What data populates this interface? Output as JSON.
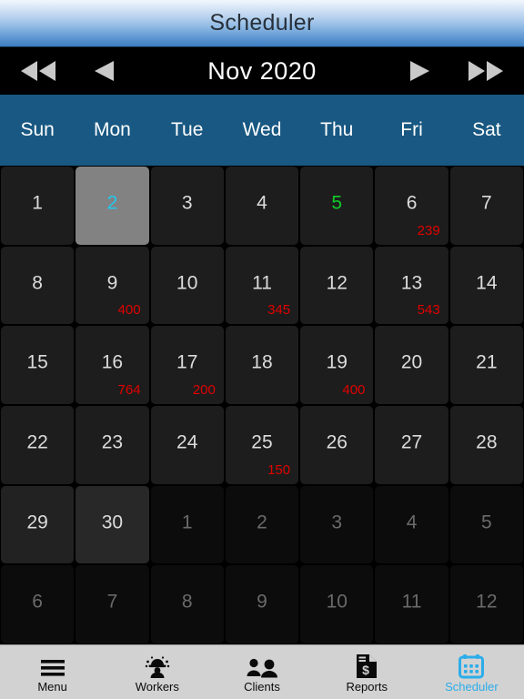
{
  "titlebar": {
    "title": "Scheduler"
  },
  "nav": {
    "month_label": "Nov 2020",
    "prev_year_icon": "double-chevron-left-icon",
    "prev_month_icon": "chevron-left-icon",
    "next_month_icon": "chevron-right-icon",
    "next_year_icon": "double-chevron-right-icon"
  },
  "weekdays": [
    "Sun",
    "Mon",
    "Tue",
    "Wed",
    "Thu",
    "Fri",
    "Sat"
  ],
  "colors": {
    "header_blue": "#185882",
    "selected_cell": "#828282",
    "selected_text": "#21c8ee",
    "today_text": "#10cc28",
    "amount_red": "#e10000",
    "active_tab": "#2badea",
    "cell_bg": "#1d1d1d",
    "adjacent_cell_bg": "#0c0c0c"
  },
  "calendar": {
    "month": "Nov",
    "year": "2020",
    "weeks": [
      [
        {
          "day": "1",
          "amount": "",
          "state": "normal"
        },
        {
          "day": "2",
          "amount": "",
          "state": "selected"
        },
        {
          "day": "3",
          "amount": "",
          "state": "normal"
        },
        {
          "day": "4",
          "amount": "",
          "state": "normal"
        },
        {
          "day": "5",
          "amount": "",
          "state": "today"
        },
        {
          "day": "6",
          "amount": "239",
          "state": "normal"
        },
        {
          "day": "7",
          "amount": "",
          "state": "normal"
        }
      ],
      [
        {
          "day": "8",
          "amount": "",
          "state": "normal"
        },
        {
          "day": "9",
          "amount": "400",
          "state": "normal"
        },
        {
          "day": "10",
          "amount": "",
          "state": "normal"
        },
        {
          "day": "11",
          "amount": "345",
          "state": "normal"
        },
        {
          "day": "12",
          "amount": "",
          "state": "normal"
        },
        {
          "day": "13",
          "amount": "543",
          "state": "normal"
        },
        {
          "day": "14",
          "amount": "",
          "state": "normal"
        }
      ],
      [
        {
          "day": "15",
          "amount": "",
          "state": "normal"
        },
        {
          "day": "16",
          "amount": "764",
          "state": "normal"
        },
        {
          "day": "17",
          "amount": "200",
          "state": "normal"
        },
        {
          "day": "18",
          "amount": "",
          "state": "normal"
        },
        {
          "day": "19",
          "amount": "400",
          "state": "normal"
        },
        {
          "day": "20",
          "amount": "",
          "state": "normal"
        },
        {
          "day": "21",
          "amount": "",
          "state": "normal"
        }
      ],
      [
        {
          "day": "22",
          "amount": "",
          "state": "normal"
        },
        {
          "day": "23",
          "amount": "",
          "state": "normal"
        },
        {
          "day": "24",
          "amount": "",
          "state": "normal"
        },
        {
          "day": "25",
          "amount": "150",
          "state": "normal"
        },
        {
          "day": "26",
          "amount": "",
          "state": "normal"
        },
        {
          "day": "27",
          "amount": "",
          "state": "normal"
        },
        {
          "day": "28",
          "amount": "",
          "state": "normal"
        }
      ],
      [
        {
          "day": "29",
          "amount": "",
          "state": "dim-light"
        },
        {
          "day": "30",
          "amount": "",
          "state": "lighter"
        },
        {
          "day": "1",
          "amount": "",
          "state": "adjacent"
        },
        {
          "day": "2",
          "amount": "",
          "state": "adjacent"
        },
        {
          "day": "3",
          "amount": "",
          "state": "adjacent"
        },
        {
          "day": "4",
          "amount": "",
          "state": "adjacent"
        },
        {
          "day": "5",
          "amount": "",
          "state": "adjacent"
        }
      ],
      [
        {
          "day": "6",
          "amount": "",
          "state": "adjacent"
        },
        {
          "day": "7",
          "amount": "",
          "state": "adjacent"
        },
        {
          "day": "8",
          "amount": "",
          "state": "adjacent"
        },
        {
          "day": "9",
          "amount": "",
          "state": "adjacent"
        },
        {
          "day": "10",
          "amount": "",
          "state": "adjacent"
        },
        {
          "day": "11",
          "amount": "",
          "state": "adjacent"
        },
        {
          "day": "12",
          "amount": "",
          "state": "adjacent"
        }
      ]
    ]
  },
  "tabbar": {
    "items": [
      {
        "label": "Menu",
        "icon": "hamburger-menu-icon",
        "active": false
      },
      {
        "label": "Workers",
        "icon": "hard-hat-worker-icon",
        "active": false
      },
      {
        "label": "Clients",
        "icon": "people-group-icon",
        "active": false
      },
      {
        "label": "Reports",
        "icon": "document-dollar-icon",
        "active": false
      },
      {
        "label": "Scheduler",
        "icon": "calendar-icon",
        "active": true
      }
    ]
  }
}
